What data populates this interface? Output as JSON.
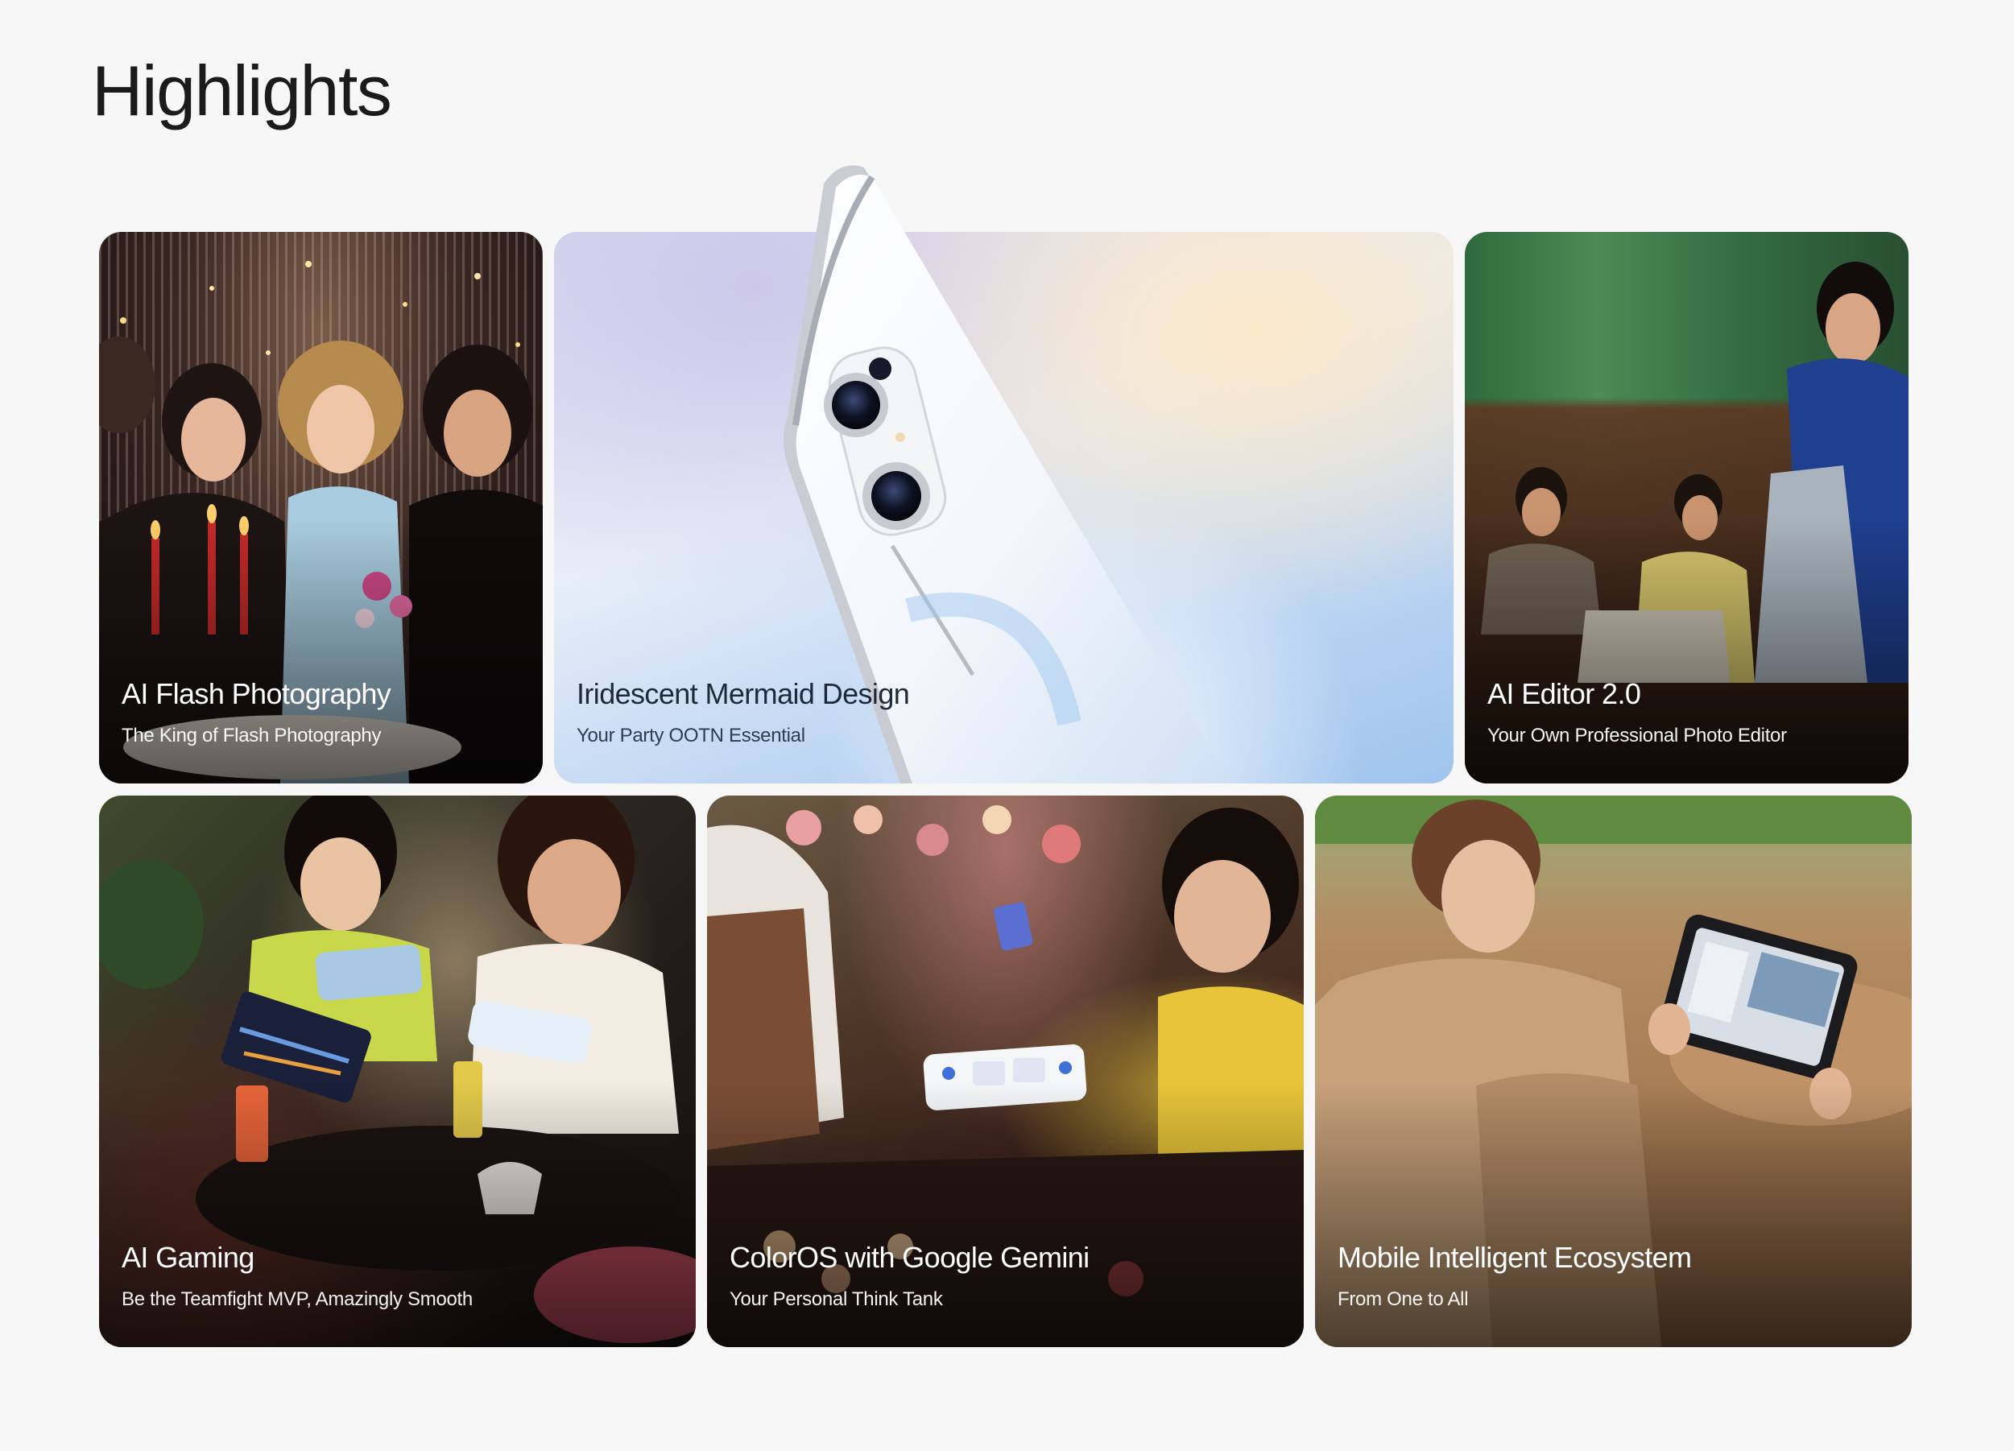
{
  "page": {
    "title": "Highlights"
  },
  "cards": [
    {
      "id": "ai-flash-photography",
      "title": "AI Flash Photography",
      "subtitle": "The King of Flash Photography"
    },
    {
      "id": "iridescent-mermaid-design",
      "title": "Iridescent Mermaid Design",
      "subtitle": "Your Party OOTN Essential"
    },
    {
      "id": "ai-editor",
      "title": "AI Editor 2.0",
      "subtitle": "Your Own Professional Photo Editor"
    },
    {
      "id": "ai-gaming",
      "title": "AI Gaming",
      "subtitle": "Be the Teamfight MVP, Amazingly Smooth"
    },
    {
      "id": "coloros-gemini",
      "title": "ColorOS with Google Gemini",
      "subtitle": "Your Personal Think Tank"
    },
    {
      "id": "mobile-ecosystem",
      "title": "Mobile Intelligent Ecosystem",
      "subtitle": "From One to All"
    }
  ],
  "colors": {
    "background": "#f7f7f7",
    "title_text": "#1b1b1b",
    "card_text": "#ffffff",
    "card_text_light": "#1e2a3a"
  }
}
